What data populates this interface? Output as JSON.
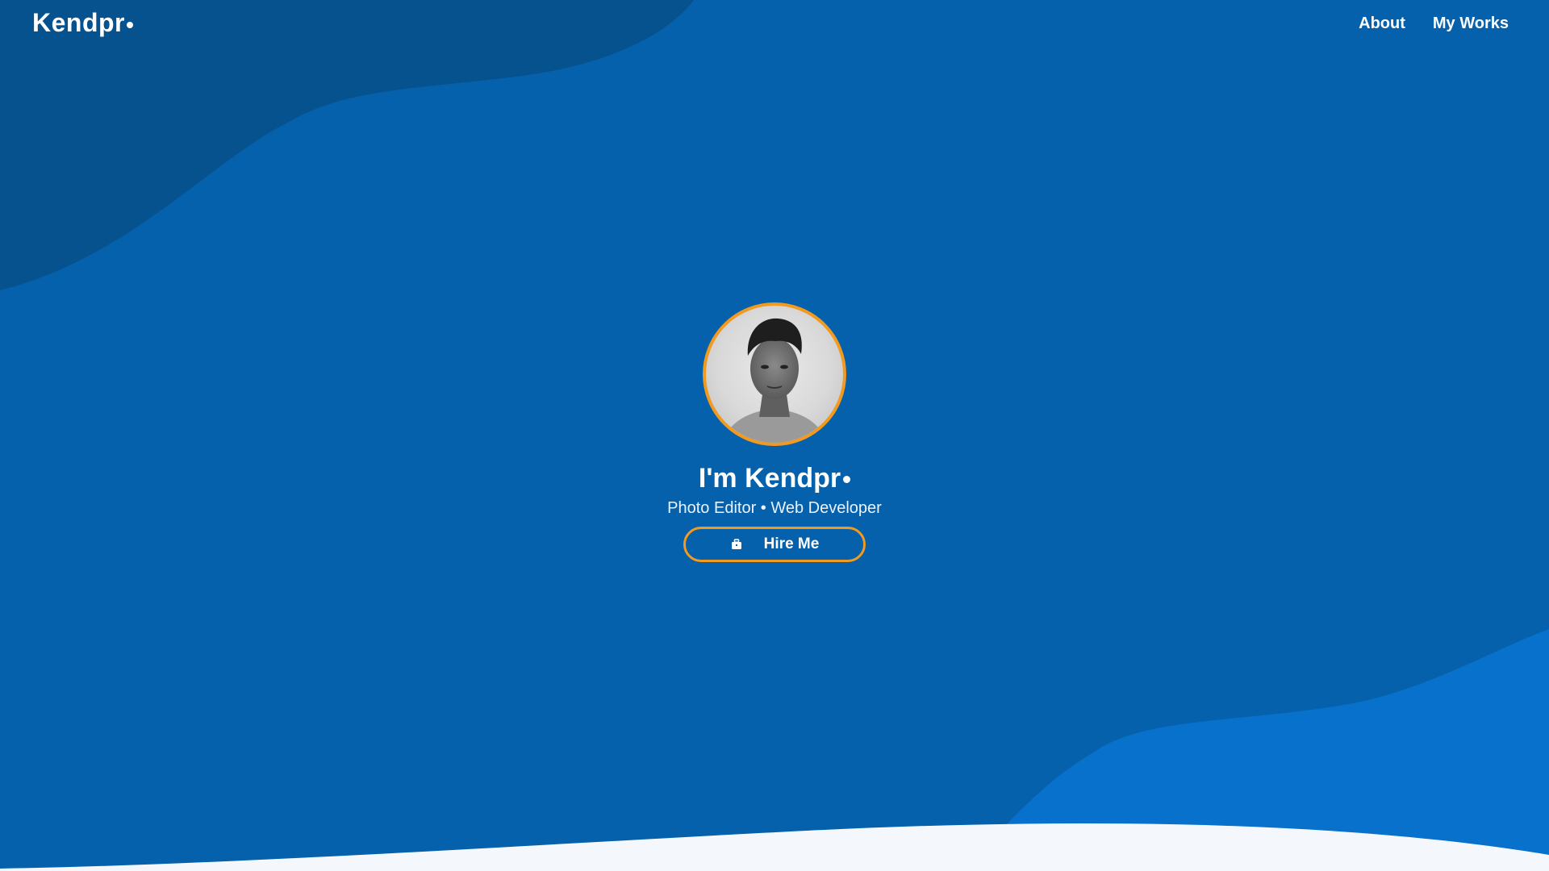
{
  "brand": {
    "name": "Kendpr"
  },
  "nav": {
    "items": [
      {
        "label": "About"
      },
      {
        "label": "My Works"
      }
    ]
  },
  "hero": {
    "title": "I'm Kendpr",
    "subtitle": "Photo Editor • Web Developer",
    "cta_label": "Hire Me",
    "cta_icon": "briefcase-icon",
    "avatar": "profile-photo"
  },
  "colors": {
    "background": "#0561ac",
    "dark_wave": "#06528f",
    "light_wave": "#0871cc",
    "footer_wave": "#f4f8fd",
    "accent": "#f29a1f",
    "text": "#ffffff"
  }
}
